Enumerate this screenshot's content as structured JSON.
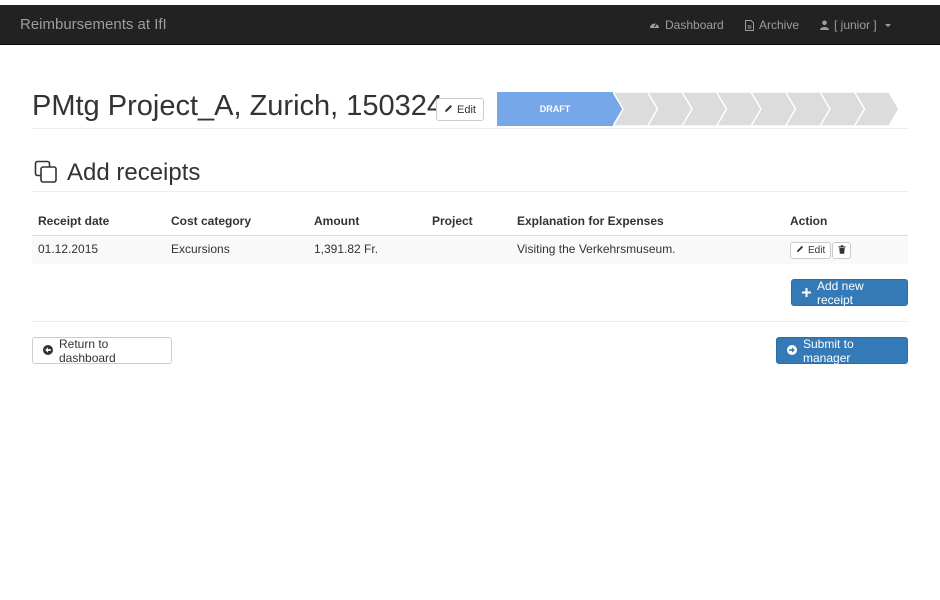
{
  "navbar": {
    "brand": "Reimbursements at IfI",
    "items": [
      {
        "label": "Dashboard",
        "icon": "dashboard-icon"
      },
      {
        "label": "Archive",
        "icon": "file-icon"
      },
      {
        "label": "[ junior ]",
        "icon": "user-icon"
      }
    ]
  },
  "header": {
    "title": "PMtg Project_A, Zurich, 150324",
    "edit_label": "Edit"
  },
  "workflow": {
    "active_step": "DRAFT",
    "total_steps": 9,
    "active_index": 0,
    "colors": {
      "active": "#76a7e9",
      "inactive": "#dcdcdc"
    }
  },
  "receipts": {
    "title": "Add receipts",
    "columns": [
      "Receipt date",
      "Cost category",
      "Amount",
      "Project",
      "Explanation for Expenses",
      "Action"
    ],
    "rows": [
      {
        "date": "01.12.2015",
        "category": "Excursions",
        "amount": "1,391.82 Fr.",
        "project": "",
        "explanation": "Visiting the Verkehrsmuseum.",
        "edit_label": "Edit"
      }
    ],
    "add_label": "Add new receipt"
  },
  "footer": {
    "return_label": "Return to dashboard",
    "submit_label": "Submit to manager"
  },
  "colors": {
    "primary": "#337ab7",
    "navbar_bg": "#222222",
    "navbar_text": "#9d9d9d"
  }
}
